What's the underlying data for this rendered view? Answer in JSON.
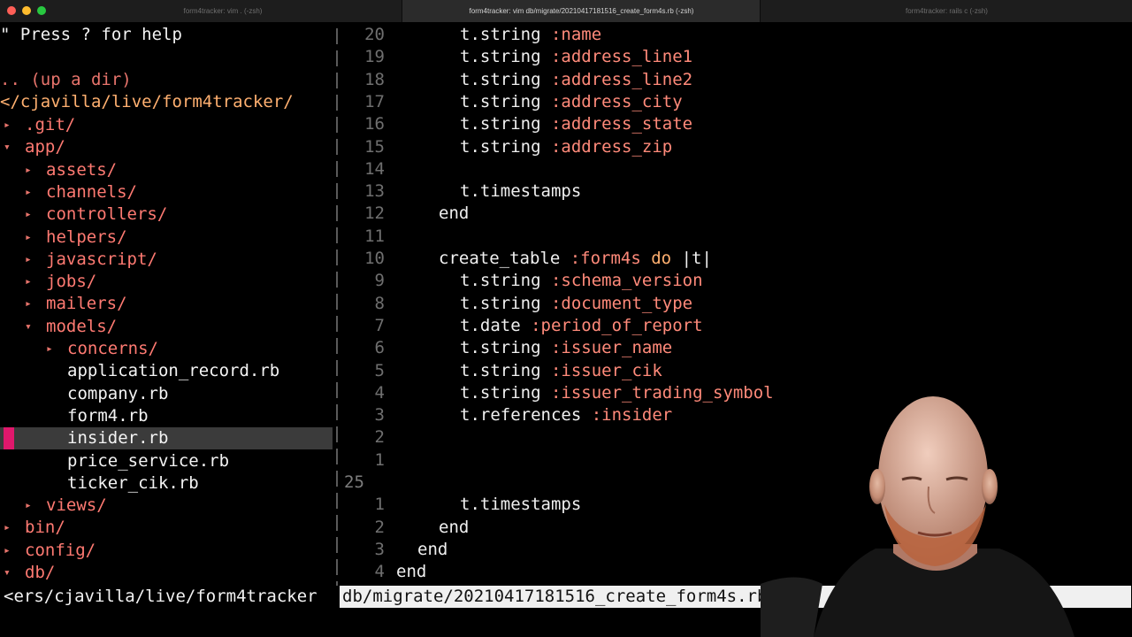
{
  "window": {
    "traffic_lights": [
      "#ff5f57",
      "#febc2e",
      "#28c840"
    ],
    "tabs": [
      {
        "label": "form4tracker: vim . (-zsh)",
        "active": false
      },
      {
        "label": "form4tracker: vim db/migrate/20210417181516_create_form4s.rb (-zsh)",
        "active": true
      },
      {
        "label": "form4tracker: rails c (-zsh)",
        "active": false
      }
    ]
  },
  "tree": {
    "help": "\" Press ? for help",
    "updir": ".. (up a dir)",
    "root": "</cjavilla/live/form4tracker/",
    "items": [
      {
        "arrow": "▸",
        "name": ".git/",
        "type": "dir"
      },
      {
        "arrow": "▾",
        "name": "app/",
        "type": "dir"
      },
      {
        "arrow": "▸",
        "name": "assets/",
        "type": "dir"
      },
      {
        "arrow": "▸",
        "name": "channels/",
        "type": "dir"
      },
      {
        "arrow": "▸",
        "name": "controllers/",
        "type": "dir"
      },
      {
        "arrow": "▸",
        "name": "helpers/",
        "type": "dir"
      },
      {
        "arrow": "▸",
        "name": "javascript/",
        "type": "dir"
      },
      {
        "arrow": "▸",
        "name": "jobs/",
        "type": "dir"
      },
      {
        "arrow": "▸",
        "name": "mailers/",
        "type": "dir"
      },
      {
        "arrow": "▾",
        "name": "models/",
        "type": "dir"
      },
      {
        "arrow": "▸",
        "name": "concerns/",
        "type": "dir"
      },
      {
        "arrow": "",
        "name": "application_record.rb",
        "type": "file"
      },
      {
        "arrow": "",
        "name": "company.rb",
        "type": "file"
      },
      {
        "arrow": "",
        "name": "form4.rb",
        "type": "file"
      },
      {
        "arrow": "",
        "name": "insider.rb",
        "type": "file",
        "selected": true
      },
      {
        "arrow": "",
        "name": "price_service.rb",
        "type": "file"
      },
      {
        "arrow": "",
        "name": "ticker_cik.rb",
        "type": "file"
      },
      {
        "arrow": "▸",
        "name": "views/",
        "type": "dir"
      },
      {
        "arrow": "▸",
        "name": "bin/",
        "type": "dir"
      },
      {
        "arrow": "▸",
        "name": "config/",
        "type": "dir"
      },
      {
        "arrow": "▾",
        "name": "db/",
        "type": "dir"
      }
    ]
  },
  "code": {
    "lines": [
      {
        "num": "20",
        "indent": 3,
        "parts": [
          [
            "t.string ",
            "p"
          ],
          [
            ":name",
            "s"
          ]
        ]
      },
      {
        "num": "19",
        "indent": 3,
        "parts": [
          [
            "t.string ",
            "p"
          ],
          [
            ":address_line1",
            "s"
          ]
        ]
      },
      {
        "num": "18",
        "indent": 3,
        "parts": [
          [
            "t.string ",
            "p"
          ],
          [
            ":address_line2",
            "s"
          ]
        ]
      },
      {
        "num": "17",
        "indent": 3,
        "parts": [
          [
            "t.string ",
            "p"
          ],
          [
            ":address_city",
            "s"
          ]
        ]
      },
      {
        "num": "16",
        "indent": 3,
        "parts": [
          [
            "t.string ",
            "p"
          ],
          [
            ":address_state",
            "s"
          ]
        ]
      },
      {
        "num": "15",
        "indent": 3,
        "parts": [
          [
            "t.string ",
            "p"
          ],
          [
            ":address_zip",
            "s"
          ]
        ]
      },
      {
        "num": "14",
        "indent": 0,
        "parts": []
      },
      {
        "num": "13",
        "indent": 3,
        "parts": [
          [
            "t.timestamps",
            "p"
          ]
        ]
      },
      {
        "num": "12",
        "indent": 2,
        "parts": [
          [
            "end",
            "p"
          ]
        ]
      },
      {
        "num": "11",
        "indent": 0,
        "parts": []
      },
      {
        "num": "10",
        "indent": 2,
        "parts": [
          [
            "create_table ",
            "p"
          ],
          [
            ":form4s ",
            "s"
          ],
          [
            "do",
            "k"
          ],
          [
            " |t|",
            "p"
          ]
        ]
      },
      {
        "num": "9",
        "indent": 3,
        "parts": [
          [
            "t.string ",
            "p"
          ],
          [
            ":schema_version",
            "s"
          ]
        ]
      },
      {
        "num": "8",
        "indent": 3,
        "parts": [
          [
            "t.string ",
            "p"
          ],
          [
            ":document_type",
            "s"
          ]
        ]
      },
      {
        "num": "7",
        "indent": 3,
        "parts": [
          [
            "t.date ",
            "p"
          ],
          [
            ":period_of_report",
            "s"
          ]
        ]
      },
      {
        "num": "6",
        "indent": 3,
        "parts": [
          [
            "t.string ",
            "p"
          ],
          [
            ":issuer_name",
            "s"
          ]
        ]
      },
      {
        "num": "5",
        "indent": 3,
        "parts": [
          [
            "t.string ",
            "p"
          ],
          [
            ":issuer_cik",
            "s"
          ]
        ]
      },
      {
        "num": "4",
        "indent": 3,
        "parts": [
          [
            "t.string ",
            "p"
          ],
          [
            ":issuer_trading_symbol",
            "s"
          ]
        ]
      },
      {
        "num": "3",
        "indent": 3,
        "parts": [
          [
            "t.references ",
            "p"
          ],
          [
            ":insider",
            "s"
          ]
        ]
      },
      {
        "num": "2",
        "indent": 0,
        "parts": []
      },
      {
        "num": "1",
        "indent": 0,
        "parts": []
      },
      {
        "num": "25",
        "indent": 0,
        "parts": [],
        "current": true
      },
      {
        "num": "1",
        "indent": 3,
        "parts": [
          [
            "t.timestamps",
            "p"
          ]
        ]
      },
      {
        "num": "2",
        "indent": 2,
        "parts": [
          [
            "end",
            "p"
          ]
        ]
      },
      {
        "num": "3",
        "indent": 1,
        "parts": [
          [
            "end",
            "p"
          ]
        ]
      },
      {
        "num": "4",
        "indent": 0,
        "parts": [
          [
            "end",
            "p"
          ]
        ]
      }
    ]
  },
  "status": {
    "left": "<ers/cjavilla/live/form4tracker",
    "right": "db/migrate/20210417181516_create_form4s.rb"
  }
}
